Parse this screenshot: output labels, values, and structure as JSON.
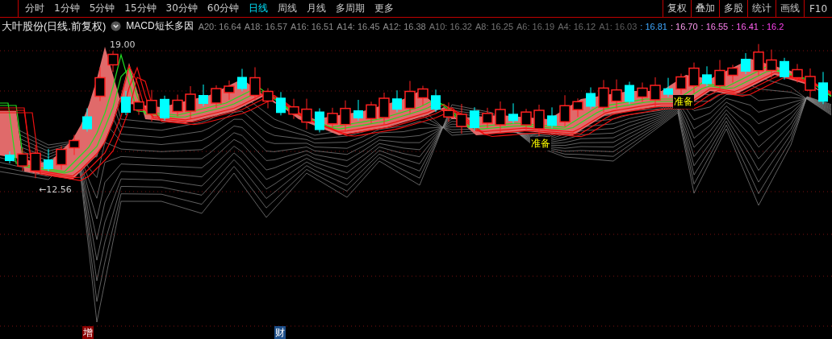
{
  "toolbar": {
    "periods": [
      {
        "label": "分时",
        "selected": false
      },
      {
        "label": "1分钟",
        "selected": false
      },
      {
        "label": "5分钟",
        "selected": false
      },
      {
        "label": "15分钟",
        "selected": false
      },
      {
        "label": "30分钟",
        "selected": false
      },
      {
        "label": "60分钟",
        "selected": false
      },
      {
        "label": "日线",
        "selected": true
      },
      {
        "label": "周线",
        "selected": false
      },
      {
        "label": "月线",
        "selected": false
      },
      {
        "label": "多周期",
        "selected": false
      },
      {
        "label": "更多",
        "selected": false
      }
    ],
    "buttons": [
      "复权",
      "叠加",
      "多股",
      "统计",
      "画线",
      "F10"
    ]
  },
  "header": {
    "title": "大叶股份(日线.前复权)",
    "indicator": "MACD短长多因",
    "values": [
      {
        "text": "A20: 16.64",
        "color": "#8c8c8c"
      },
      {
        "text": "A18: 16.57",
        "color": "#8c8c8c"
      },
      {
        "text": "A16: 16.51",
        "color": "#8c8c8c"
      },
      {
        "text": "A14: 16.45",
        "color": "#8c8c8c"
      },
      {
        "text": "A12: 16.38",
        "color": "#8c8c8c"
      },
      {
        "text": "A10: 16.32",
        "color": "#767676"
      },
      {
        "text": "A8: 16.25",
        "color": "#767676"
      },
      {
        "text": "A6: 16.19",
        "color": "#6a6a6a"
      },
      {
        "text": "A4: 16.12",
        "color": "#6a6a6a"
      },
      {
        "text": "A1: 16.03",
        "color": "#5e5e5e"
      },
      {
        "text": ": 16.81",
        "color": "#3fa8ff"
      },
      {
        "text": ": 16.70",
        "color": "#ff9cf0"
      },
      {
        "text": ": 16.55",
        "color": "#ff80f0"
      },
      {
        "text": ": 16.41",
        "color": "#ff60f0"
      },
      {
        "text": ": 16.2",
        "color": "#ff40f0"
      }
    ]
  },
  "chart": {
    "high_label": "19.00",
    "low_label": "←12.56",
    "signals": [
      "准备",
      "准备"
    ],
    "markers": [
      {
        "text": "增",
        "color": "#8b0000"
      },
      {
        "text": "财",
        "color": "#1e4f8a"
      }
    ]
  }
}
